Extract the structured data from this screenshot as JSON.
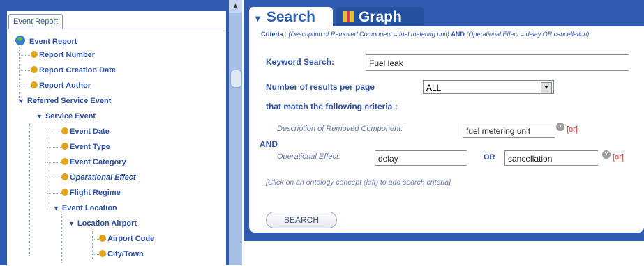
{
  "left_panel": {
    "tab_label": "Event Report",
    "tree": [
      {
        "label": "Event Report",
        "kind": "root"
      },
      {
        "label": "Report Number",
        "kind": "leaf"
      },
      {
        "label": "Report Creation Date",
        "kind": "leaf"
      },
      {
        "label": "Report Author",
        "kind": "leaf"
      },
      {
        "label": "Referred Service Event",
        "kind": "expanded"
      },
      {
        "label": "Service Event",
        "kind": "expanded"
      },
      {
        "label": "Event Date",
        "kind": "leaf"
      },
      {
        "label": "Event Type",
        "kind": "leaf"
      },
      {
        "label": "Event Category",
        "kind": "leaf"
      },
      {
        "label": "Operational Effect",
        "kind": "leaf"
      },
      {
        "label": "Flight Regime",
        "kind": "leaf"
      },
      {
        "label": "Event Location",
        "kind": "expanded"
      },
      {
        "label": "Location Airport",
        "kind": "expanded"
      },
      {
        "label": "Airport Code",
        "kind": "leaf"
      },
      {
        "label": "City/Town",
        "kind": "leaf"
      }
    ]
  },
  "tabs": {
    "search": "Search",
    "graph": "Graph"
  },
  "criteria_line": {
    "prefix": "Criteria :",
    "part1": "(Description of Removed Component = fuel metering unit)",
    "and": "AND",
    "part2": "(Operational Effect = delay OR cancellation)"
  },
  "form": {
    "keyword_label": "Keyword Search:",
    "keyword_value": "Fuel leak",
    "results_label": "Number of results per page",
    "results_value": "ALL",
    "match_label": "that match the following criteria :",
    "crit1_label": "Description of Removed Component:",
    "crit1_value": "fuel metering unit",
    "or_link": "[or]",
    "and_label": "AND",
    "crit2_label": "Operational Effect:",
    "crit2_value1": "delay",
    "or_label": "OR",
    "crit2_value2": "cancellation",
    "hint": "[Click on an ontology concept (left) to add search criteria]",
    "search_button": "SEARCH"
  },
  "colors": {
    "frame_blue": "#2e5bb0",
    "link_blue": "#2b4fa3",
    "or_red": "#d23030"
  }
}
